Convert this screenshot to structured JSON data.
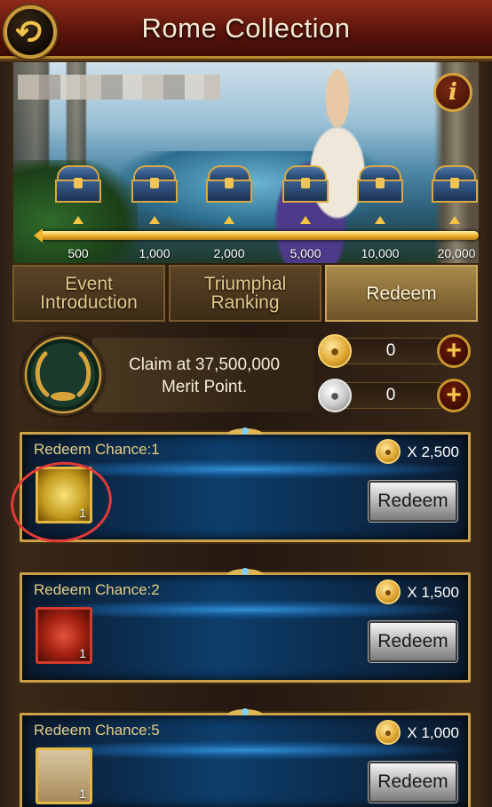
{
  "header": {
    "title": "Rome Collection",
    "back_icon": "back-arrow-icon"
  },
  "banner": {
    "info_label": "i",
    "milestones": [
      "500",
      "1,000",
      "2,000",
      "5,000",
      "10,000",
      "20,000"
    ]
  },
  "tabs": [
    {
      "label_line1": "Event",
      "label_line2": "Introduction",
      "active": false
    },
    {
      "label_line1": "Triumphal",
      "label_line2": "Ranking",
      "active": false
    },
    {
      "label_line1": "Redeem",
      "label_line2": "",
      "active": true
    }
  ],
  "claim": {
    "line1": "Claim at 37,500,000",
    "line2": "Merit Point."
  },
  "currencies": [
    {
      "type": "gold-coin",
      "value": "0"
    },
    {
      "type": "silver-coin",
      "value": "0"
    }
  ],
  "cards": [
    {
      "chance": "Redeem Chance:1",
      "cost": "X 2,500",
      "item": "gold-wreath-icon",
      "qty": "1",
      "button": "Redeem"
    },
    {
      "chance": "Redeem Chance:2",
      "cost": "X 1,500",
      "item": "red-armor-icon",
      "qty": "1",
      "button": "Redeem"
    },
    {
      "chance": "Redeem Chance:5",
      "cost": "X 1,000",
      "item": "portrait-scroll-icon",
      "qty": "1",
      "button": "Redeem"
    }
  ],
  "colors": {
    "accent_gold": "#caa04a",
    "header_red": "#8e2a1a",
    "card_blue": "#0d3e6c",
    "annotation_red": "#e23a3a"
  }
}
